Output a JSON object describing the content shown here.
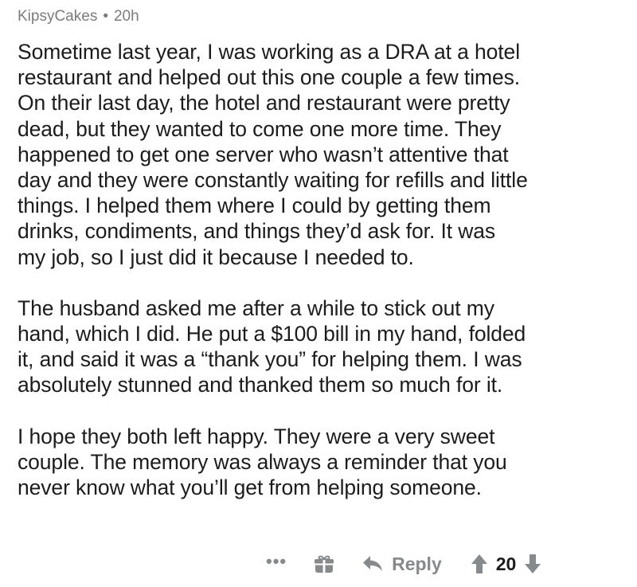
{
  "comment": {
    "author": "KipsyCakes",
    "separator": "•",
    "age": "20h",
    "paragraphs": [
      "Sometime last year, I was working as a DRA at a hotel\nrestaurant and helped out this one couple a few times.\nOn their last day, the hotel and restaurant were pretty\ndead, but they wanted to come one more time.  They\nhappened to get one server who wasn’t attentive that\nday and they were constantly waiting for refills and little\nthings.  I helped them where I could by getting them\ndrinks, condiments, and things they’d ask for.  It was\nmy job, so I just did it because I needed to.",
      "The husband asked me after a while to stick out my\nhand, which I did.  He put a $100 bill in my hand, folded\nit, and said it was a “thank you” for helping them.  I was\nabsolutely stunned and thanked them so much for it.",
      "I hope they both left happy.  They were a very sweet\ncouple.  The memory was always a reminder that you\nnever know what you’ll get from helping someone."
    ]
  },
  "actions": {
    "more_label": "•••",
    "reply_label": "Reply",
    "score": "20"
  },
  "icons": {
    "gift": "gift-icon",
    "reply": "reply-arrow-icon",
    "upvote": "upvote-arrow-icon",
    "downvote": "downvote-arrow-icon"
  },
  "colors": {
    "text": "#1c1c1c",
    "meta": "#7c7c7c",
    "action": "#878a8c"
  }
}
